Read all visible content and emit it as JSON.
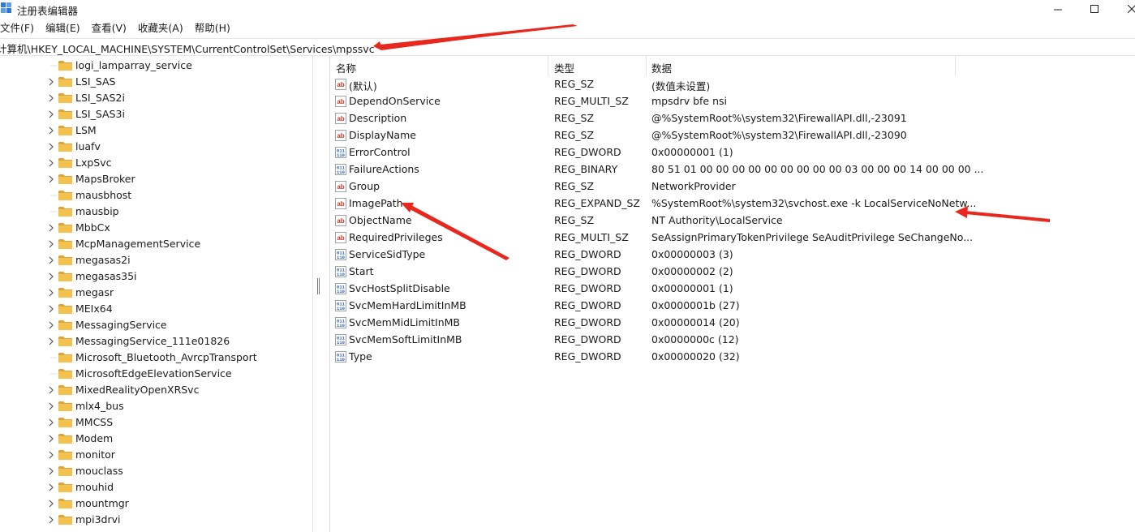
{
  "window": {
    "title": "注册表编辑器"
  },
  "menu": [
    "文件(F)",
    "编辑(E)",
    "查看(V)",
    "收藏夹(A)",
    "帮助(H)"
  ],
  "address": "计算机\\HKEY_LOCAL_MACHINE\\SYSTEM\\CurrentControlSet\\Services\\mpssvc",
  "tree": [
    {
      "label": "logi_lamparray_service",
      "expandable": false
    },
    {
      "label": "LSI_SAS",
      "expandable": true
    },
    {
      "label": "LSI_SAS2i",
      "expandable": true
    },
    {
      "label": "LSI_SAS3i",
      "expandable": true
    },
    {
      "label": "LSM",
      "expandable": true
    },
    {
      "label": "luafv",
      "expandable": true
    },
    {
      "label": "LxpSvc",
      "expandable": true
    },
    {
      "label": "MapsBroker",
      "expandable": true
    },
    {
      "label": "mausbhost",
      "expandable": false
    },
    {
      "label": "mausbip",
      "expandable": false
    },
    {
      "label": "MbbCx",
      "expandable": true
    },
    {
      "label": "McpManagementService",
      "expandable": true
    },
    {
      "label": "megasas2i",
      "expandable": true
    },
    {
      "label": "megasas35i",
      "expandable": true
    },
    {
      "label": "megasr",
      "expandable": true
    },
    {
      "label": "MEIx64",
      "expandable": true
    },
    {
      "label": "MessagingService",
      "expandable": true
    },
    {
      "label": "MessagingService_111e01826",
      "expandable": true
    },
    {
      "label": "Microsoft_Bluetooth_AvrcpTransport",
      "expandable": false
    },
    {
      "label": "MicrosoftEdgeElevationService",
      "expandable": false
    },
    {
      "label": "MixedRealityOpenXRSvc",
      "expandable": true
    },
    {
      "label": "mlx4_bus",
      "expandable": true
    },
    {
      "label": "MMCSS",
      "expandable": true
    },
    {
      "label": "Modem",
      "expandable": true
    },
    {
      "label": "monitor",
      "expandable": true
    },
    {
      "label": "mouclass",
      "expandable": true
    },
    {
      "label": "mouhid",
      "expandable": true
    },
    {
      "label": "mountmgr",
      "expandable": true
    },
    {
      "label": "mpi3drvi",
      "expandable": true
    }
  ],
  "columns": {
    "name": "名称",
    "type": "类型",
    "data": "数据"
  },
  "values": [
    {
      "icon": "string-value-icon",
      "name": "(默认)",
      "type": "REG_SZ",
      "data": "(数值未设置)"
    },
    {
      "icon": "string-value-icon",
      "name": "DependOnService",
      "type": "REG_MULTI_SZ",
      "data": "mpsdrv bfe nsi"
    },
    {
      "icon": "string-value-icon",
      "name": "Description",
      "type": "REG_SZ",
      "data": "@%SystemRoot%\\system32\\FirewallAPI.dll,-23091"
    },
    {
      "icon": "string-value-icon",
      "name": "DisplayName",
      "type": "REG_SZ",
      "data": "@%SystemRoot%\\system32\\FirewallAPI.dll,-23090"
    },
    {
      "icon": "binary-value-icon",
      "name": "ErrorControl",
      "type": "REG_DWORD",
      "data": "0x00000001 (1)"
    },
    {
      "icon": "binary-value-icon",
      "name": "FailureActions",
      "type": "REG_BINARY",
      "data": "80 51 01 00 00 00 00 00 00 00 00 00 03 00 00 00 14 00 00 00 ..."
    },
    {
      "icon": "string-value-icon",
      "name": "Group",
      "type": "REG_SZ",
      "data": "NetworkProvider"
    },
    {
      "icon": "string-value-icon",
      "name": "ImagePath",
      "type": "REG_EXPAND_SZ",
      "data": "%SystemRoot%\\system32\\svchost.exe -k LocalServiceNoNetw..."
    },
    {
      "icon": "string-value-icon",
      "name": "ObjectName",
      "type": "REG_SZ",
      "data": "NT Authority\\LocalService"
    },
    {
      "icon": "string-value-icon",
      "name": "RequiredPrivileges",
      "type": "REG_MULTI_SZ",
      "data": "SeAssignPrimaryTokenPrivilege SeAuditPrivilege SeChangeNo..."
    },
    {
      "icon": "binary-value-icon",
      "name": "ServiceSidType",
      "type": "REG_DWORD",
      "data": "0x00000003 (3)"
    },
    {
      "icon": "binary-value-icon",
      "name": "Start",
      "type": "REG_DWORD",
      "data": "0x00000002 (2)"
    },
    {
      "icon": "binary-value-icon",
      "name": "SvcHostSplitDisable",
      "type": "REG_DWORD",
      "data": "0x00000001 (1)"
    },
    {
      "icon": "binary-value-icon",
      "name": "SvcMemHardLimitInMB",
      "type": "REG_DWORD",
      "data": "0x0000001b (27)"
    },
    {
      "icon": "binary-value-icon",
      "name": "SvcMemMidLimitInMB",
      "type": "REG_DWORD",
      "data": "0x00000014 (20)"
    },
    {
      "icon": "binary-value-icon",
      "name": "SvcMemSoftLimitInMB",
      "type": "REG_DWORD",
      "data": "0x0000000c (12)"
    },
    {
      "icon": "binary-value-icon",
      "name": "Type",
      "type": "REG_DWORD",
      "data": "0x00000020 (32)"
    }
  ],
  "colors": {
    "folder": "#f2c14e",
    "folder_dark": "#dca536",
    "string_icon": "#c0392b",
    "binary_icon": "#2b5fb4",
    "annotation_arrow": "#e8281e"
  }
}
